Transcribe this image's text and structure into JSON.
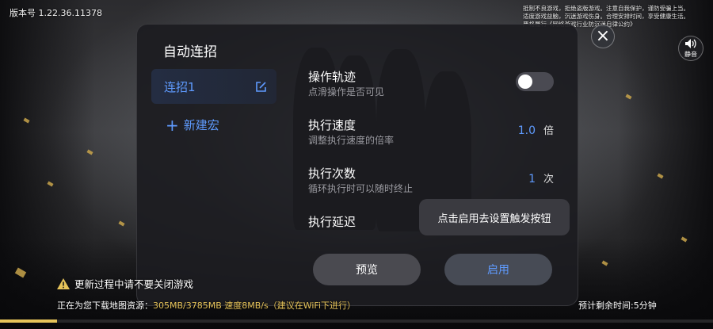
{
  "top": {
    "version_label": "版本号",
    "version_number": "1.22.36.11378",
    "health_notice": [
      "抵制不良游戏，拒绝盗版游戏。注意自我保护，谨防受骗上当。",
      "适度游戏益脑，沉迷游戏伤身。合理安排时间，享受健康生活。",
      "严格履行《网络游戏行业防沉迷自律公约》"
    ]
  },
  "mute_label": "静音",
  "panel": {
    "title": "自动连招",
    "sidebar": {
      "active_item": "连招1",
      "new_macro_label": "新建宏"
    },
    "settings": [
      {
        "title": "操作轨迹",
        "subtitle": "点滑操作是否可见",
        "toggle_on": false
      },
      {
        "title": "执行速度",
        "subtitle": "调整执行速度的倍率",
        "value": "1.0",
        "unit": "倍"
      },
      {
        "title": "执行次数",
        "subtitle": "循环执行时可以随时终止",
        "value": "1",
        "unit": "次"
      },
      {
        "title": "执行延迟"
      }
    ],
    "tooltip": "点击启用去设置触发按钮",
    "buttons": {
      "preview": "预览",
      "enable": "启用"
    }
  },
  "bottom": {
    "warning": "更新过程中请不要关闭游戏",
    "download_prefix": "正在为您下载地图资源：",
    "download_detail": "305MB/3785MB 速度8MB/s（建议在WiFi下进行）",
    "eta": "预计剩余时间:5分钟",
    "progress": 0.08
  },
  "colors": {
    "accent": "#5f9bff",
    "warning": "#e7c45a"
  }
}
